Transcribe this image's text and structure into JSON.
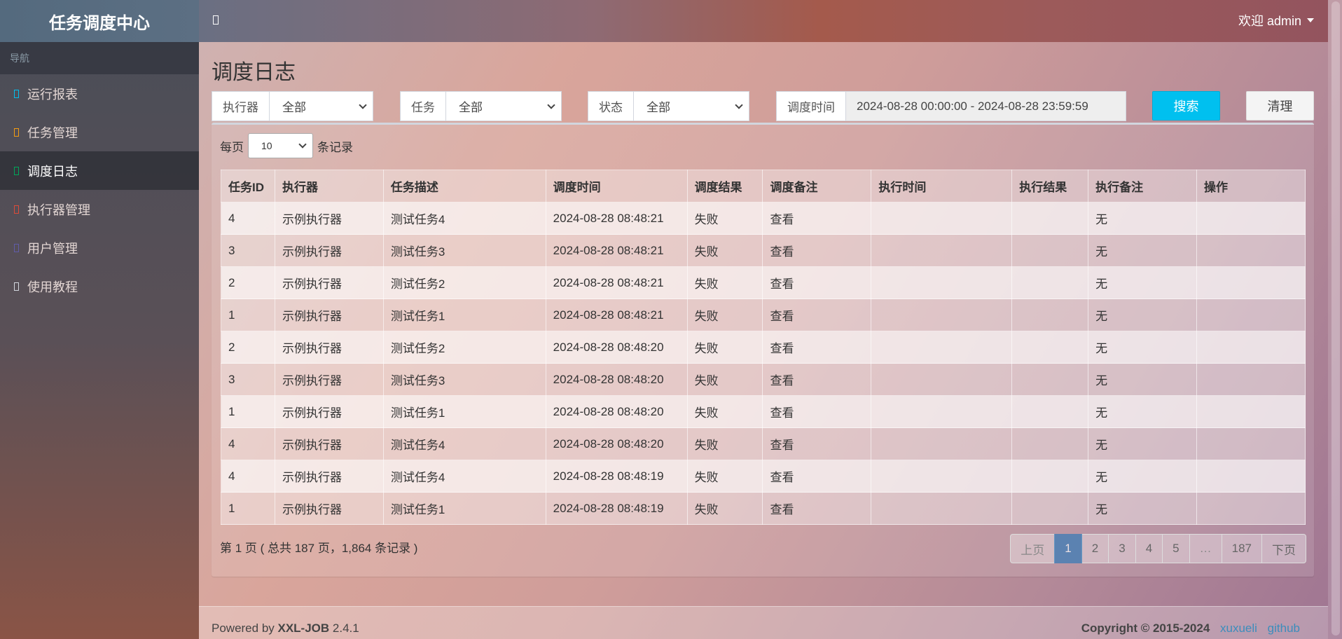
{
  "app": {
    "title": "任务调度中心"
  },
  "header": {
    "user_label": "欢迎 admin"
  },
  "sidebar": {
    "header": "导航",
    "items": [
      {
        "label": "运行报表",
        "icon_color": "#00c0ef"
      },
      {
        "label": "任务管理",
        "icon_color": "#f39c12"
      },
      {
        "label": "调度日志",
        "icon_color": "#00a65a",
        "active": true
      },
      {
        "label": "执行器管理",
        "icon_color": "#dd4b39"
      },
      {
        "label": "用户管理",
        "icon_color": "#605ca8"
      },
      {
        "label": "使用教程",
        "icon_color": "#d2d6de"
      }
    ]
  },
  "page": {
    "title": "调度日志"
  },
  "filters": {
    "executor": {
      "label": "执行器",
      "value": "全部"
    },
    "job": {
      "label": "任务",
      "value": "全部"
    },
    "status": {
      "label": "状态",
      "value": "全部"
    },
    "time": {
      "label": "调度时间",
      "value": "2024-08-28 00:00:00 - 2024-08-28 23:59:59"
    },
    "search_label": "搜索",
    "clear_label": "清理"
  },
  "length": {
    "prefix": "每页",
    "value": "10",
    "suffix": "条记录"
  },
  "table": {
    "columns": [
      "任务ID",
      "执行器",
      "任务描述",
      "调度时间",
      "调度结果",
      "调度备注",
      "执行时间",
      "执行结果",
      "执行备注",
      "操作"
    ],
    "rows": [
      {
        "id": "4",
        "executor": "示例执行器",
        "desc": "测试任务4",
        "trigger_time": "2024-08-28 08:48:21",
        "trigger_result": "失败",
        "trigger_msg": "查看",
        "handle_time": "",
        "handle_result": "",
        "handle_msg": "无",
        "op": ""
      },
      {
        "id": "3",
        "executor": "示例执行器",
        "desc": "测试任务3",
        "trigger_time": "2024-08-28 08:48:21",
        "trigger_result": "失败",
        "trigger_msg": "查看",
        "handle_time": "",
        "handle_result": "",
        "handle_msg": "无",
        "op": ""
      },
      {
        "id": "2",
        "executor": "示例执行器",
        "desc": "测试任务2",
        "trigger_time": "2024-08-28 08:48:21",
        "trigger_result": "失败",
        "trigger_msg": "查看",
        "handle_time": "",
        "handle_result": "",
        "handle_msg": "无",
        "op": ""
      },
      {
        "id": "1",
        "executor": "示例执行器",
        "desc": "测试任务1",
        "trigger_time": "2024-08-28 08:48:21",
        "trigger_result": "失败",
        "trigger_msg": "查看",
        "handle_time": "",
        "handle_result": "",
        "handle_msg": "无",
        "op": ""
      },
      {
        "id": "2",
        "executor": "示例执行器",
        "desc": "测试任务2",
        "trigger_time": "2024-08-28 08:48:20",
        "trigger_result": "失败",
        "trigger_msg": "查看",
        "handle_time": "",
        "handle_result": "",
        "handle_msg": "无",
        "op": ""
      },
      {
        "id": "3",
        "executor": "示例执行器",
        "desc": "测试任务3",
        "trigger_time": "2024-08-28 08:48:20",
        "trigger_result": "失败",
        "trigger_msg": "查看",
        "handle_time": "",
        "handle_result": "",
        "handle_msg": "无",
        "op": ""
      },
      {
        "id": "1",
        "executor": "示例执行器",
        "desc": "测试任务1",
        "trigger_time": "2024-08-28 08:48:20",
        "trigger_result": "失败",
        "trigger_msg": "查看",
        "handle_time": "",
        "handle_result": "",
        "handle_msg": "无",
        "op": ""
      },
      {
        "id": "4",
        "executor": "示例执行器",
        "desc": "测试任务4",
        "trigger_time": "2024-08-28 08:48:20",
        "trigger_result": "失败",
        "trigger_msg": "查看",
        "handle_time": "",
        "handle_result": "",
        "handle_msg": "无",
        "op": ""
      },
      {
        "id": "4",
        "executor": "示例执行器",
        "desc": "测试任务4",
        "trigger_time": "2024-08-28 08:48:19",
        "trigger_result": "失败",
        "trigger_msg": "查看",
        "handle_time": "",
        "handle_result": "",
        "handle_msg": "无",
        "op": ""
      },
      {
        "id": "1",
        "executor": "示例执行器",
        "desc": "测试任务1",
        "trigger_time": "2024-08-28 08:48:19",
        "trigger_result": "失败",
        "trigger_msg": "查看",
        "handle_time": "",
        "handle_result": "",
        "handle_msg": "无",
        "op": ""
      }
    ]
  },
  "info": {
    "text": "第 1 页 ( 总共 187 页，1,864 条记录 )"
  },
  "pagination": {
    "prev": "上页",
    "pages": [
      "1",
      "2",
      "3",
      "4",
      "5",
      "…",
      "187"
    ],
    "current": "1",
    "next": "下页"
  },
  "footer": {
    "powered_prefix": "Powered by ",
    "product": "XXL-JOB",
    "version": " 2.4.1",
    "copyright": "Copyright © 2015-2024",
    "author_link": "xuxueli",
    "github_link": "github"
  },
  "colors": {
    "link": "#3c8dbc",
    "fail": "#ff0000",
    "search_button": "#00c0ef"
  }
}
